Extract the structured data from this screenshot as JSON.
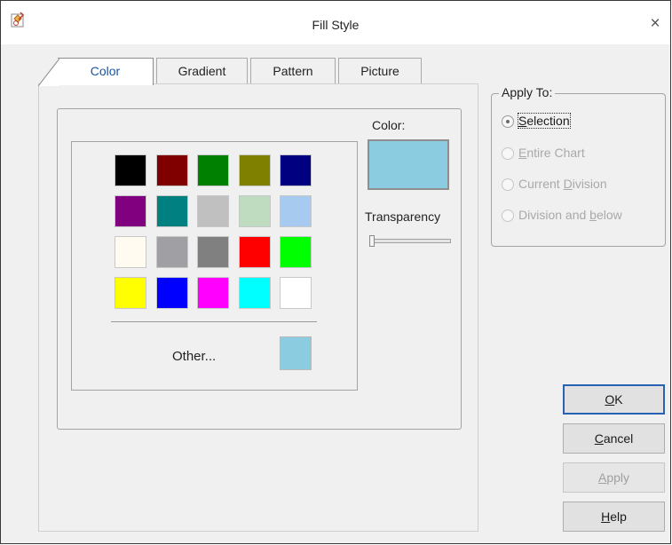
{
  "window": {
    "title": "Fill Style",
    "close_glyph": "×"
  },
  "tabs": [
    {
      "label": "Color",
      "active": true
    },
    {
      "label": "Gradient",
      "active": false
    },
    {
      "label": "Pattern",
      "active": false
    },
    {
      "label": "Picture",
      "active": false
    }
  ],
  "palette": {
    "colors": [
      "#000000",
      "#800000",
      "#008000",
      "#808000",
      "#000080",
      "#800080",
      "#008080",
      "#c0c0c0",
      "#c0dcc0",
      "#a6caf0",
      "#fffbf0",
      "#a0a0a4",
      "#808080",
      "#ff0000",
      "#00ff00",
      "#ffff00",
      "#0000ff",
      "#ff00ff",
      "#00ffff",
      "#ffffff"
    ],
    "other_label": "Other...",
    "other_color": "#8ccce0"
  },
  "color_preview": {
    "label": "Color:",
    "value": "#8ccce0"
  },
  "transparency": {
    "label": "Transparency",
    "value": 0
  },
  "apply_to": {
    "legend": "Apply To:",
    "options": [
      {
        "label": "Selection",
        "accel": "S",
        "rest": "election",
        "selected": true,
        "enabled": true
      },
      {
        "label": "Entire Chart",
        "accel": "E",
        "rest": "ntire Chart",
        "selected": false,
        "enabled": false
      },
      {
        "label": "Current Division",
        "pre": "Current ",
        "accel": "D",
        "rest": "ivision",
        "selected": false,
        "enabled": false
      },
      {
        "label": "Division and below",
        "pre": "Division and ",
        "accel": "b",
        "rest": "elow",
        "selected": false,
        "enabled": false
      }
    ]
  },
  "buttons": {
    "ok": {
      "accel": "O",
      "rest": "K"
    },
    "cancel": {
      "accel": "C",
      "rest": "ancel"
    },
    "apply": {
      "accel": "A",
      "rest": "pply",
      "enabled": false
    },
    "help": {
      "accel": "H",
      "rest": "elp"
    }
  }
}
